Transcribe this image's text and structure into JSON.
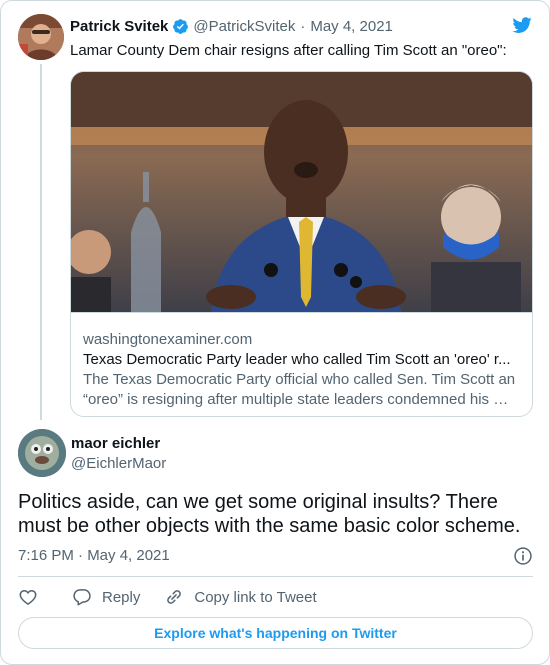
{
  "parent_tweet": {
    "author_name": "Patrick Svitek",
    "author_handle": "@PatrickSvitek",
    "separator": "·",
    "date": "May 4, 2021",
    "text": "Lamar County Dem chair resigns after calling Tim Scott an \"oreo\":",
    "link_card": {
      "domain": "washingtonexaminer.com",
      "title": "Texas Democratic Party leader who called Tim Scott an 'oreo' r...",
      "description": "The Texas Democratic Party official who called Sen. Tim Scott an “oreo” is resigning after multiple state leaders condemned his …"
    }
  },
  "main_tweet": {
    "author_name": "maor eichler",
    "author_handle": "@EichlerMaor",
    "text": "Politics aside, can we get some original insults? There must be other objects with the same basic color scheme.",
    "timestamp": "7:16 PM · May 4, 2021"
  },
  "actions": {
    "reply_label": "Reply",
    "copy_label": "Copy link to Tweet"
  },
  "explore_label": "Explore what's happening on Twitter",
  "colors": {
    "accent": "#1d9bf0",
    "text_primary": "#0f1419",
    "text_secondary": "#536471",
    "border": "#cfd9de"
  },
  "icons": [
    "verified-badge-icon",
    "twitter-bird-icon",
    "info-icon",
    "heart-icon",
    "reply-icon",
    "link-icon"
  ]
}
